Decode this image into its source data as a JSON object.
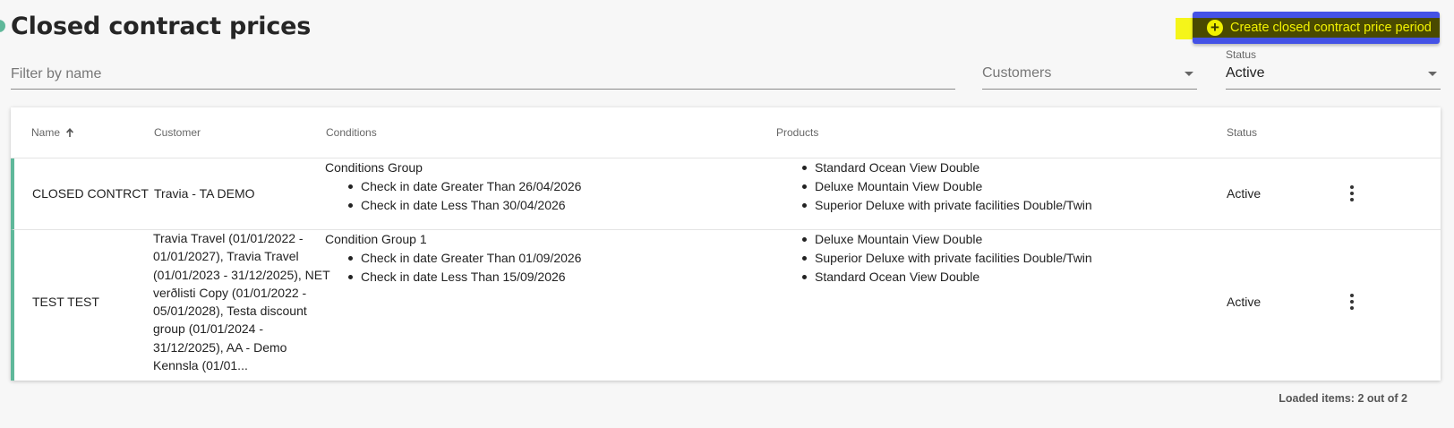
{
  "header": {
    "title": "Closed contract prices",
    "create_button_label": "Create closed contract price period",
    "create_icon": "plus-circle-icon"
  },
  "filters": {
    "name_placeholder": "Filter by name",
    "customers_placeholder": "Customers",
    "status_label": "Status",
    "status_value": "Active"
  },
  "table": {
    "columns": {
      "name": "Name",
      "customer": "Customer",
      "conditions": "Conditions",
      "products": "Products",
      "status": "Status"
    },
    "sort_icon": "arrow-up-icon",
    "rows": [
      {
        "name": "CLOSED CONTRCT",
        "customer": "Travia - TA DEMO",
        "condition_group": "Conditions Group",
        "conditions": [
          "Check in date Greater Than 26/04/2026",
          "Check in date Less Than 30/04/2026"
        ],
        "products": [
          "Standard Ocean View Double",
          "Deluxe Mountain View Double",
          "Superior Deluxe with private facilities Double/Twin"
        ],
        "status": "Active"
      },
      {
        "name": "TEST TEST",
        "customer_lines": [
          "Travia Travel (01/01/2022 -",
          "01/01/2027), Travia Travel",
          "(01/01/2023 - 31/12/2025), NET",
          "verðlisti Copy (01/01/2022 -",
          "05/01/2028), Testa discount",
          "group (01/01/2024 -",
          "31/12/2025), AA - Demo",
          "Kennsla (01/01..."
        ],
        "condition_group": "Condition Group 1",
        "conditions": [
          "Check in date Greater Than 01/09/2026",
          "Check in date Less Than 15/09/2026"
        ],
        "products": [
          "Deluxe Mountain View Double",
          "Superior Deluxe with private facilities Double/Twin",
          "Standard Ocean View Double"
        ],
        "status": "Active"
      }
    ],
    "row_menu_icon": "more-vertical-icon"
  },
  "footer": {
    "loaded_items": "Loaded items: 2 out of 2"
  },
  "colors": {
    "accent": "#5fb89a",
    "button": "#4452e6",
    "highlight": "#f5f51a"
  }
}
